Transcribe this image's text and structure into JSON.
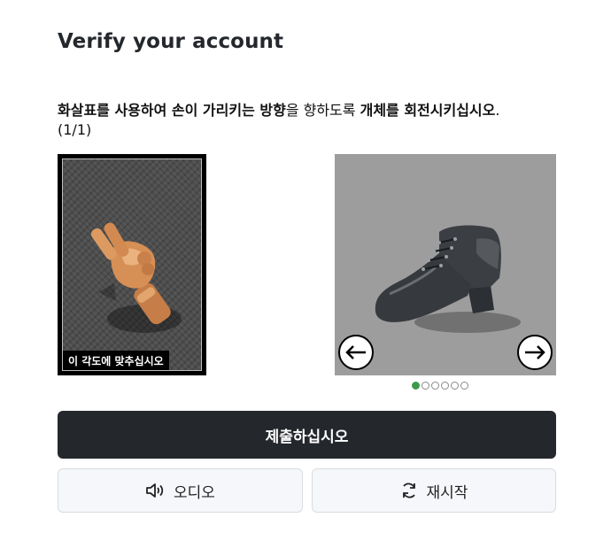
{
  "header": {
    "title": "Verify your account"
  },
  "instruction": {
    "part1_bold": "화살표를 사용하여 손이 가리키는 방향",
    "part2": "을 향하도록 ",
    "part3_bold": "개체를 회전시키십시오",
    "part4": ".",
    "progress": "(1/1)"
  },
  "reference": {
    "caption": "이 각도에 맞추십시오",
    "icon": "pointing-hand"
  },
  "object": {
    "icon": "ankle-boot",
    "background": "#9d9d9d"
  },
  "carousel": {
    "total": 6,
    "active_index": 0,
    "active_color": "#3d9a4d"
  },
  "controls": {
    "left_arrow_icon": "arrow-left-icon",
    "right_arrow_icon": "arrow-right-icon",
    "submit_label": "제출하십시오",
    "audio_label": "오디오",
    "reload_label": "재시작"
  },
  "colors": {
    "primary": "#24272c",
    "secondary_bg": "#f5f7fa"
  }
}
